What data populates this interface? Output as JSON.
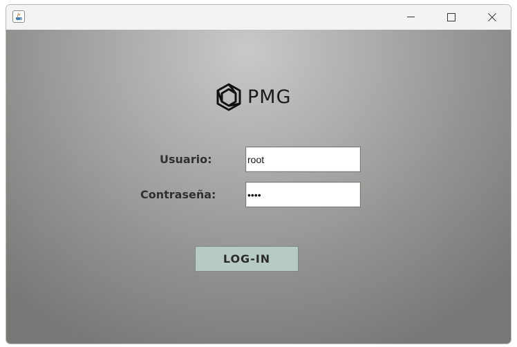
{
  "window": {
    "title": "",
    "icon": "java-cup-icon",
    "controls": [
      "minimize",
      "maximize",
      "close"
    ]
  },
  "logo": {
    "text": "PMG",
    "mark": "hexagon-swirl-logo"
  },
  "form": {
    "user_label": "Usuario:",
    "user_value": "root",
    "pass_label": "Contraseña:",
    "pass_value": "1234"
  },
  "login_button": {
    "label": "LOG-IN"
  },
  "colors": {
    "button_bg": "#b7cbc3",
    "label_text": "#303030",
    "background_center": "#c9c9c7",
    "background_edge": "#777776"
  }
}
